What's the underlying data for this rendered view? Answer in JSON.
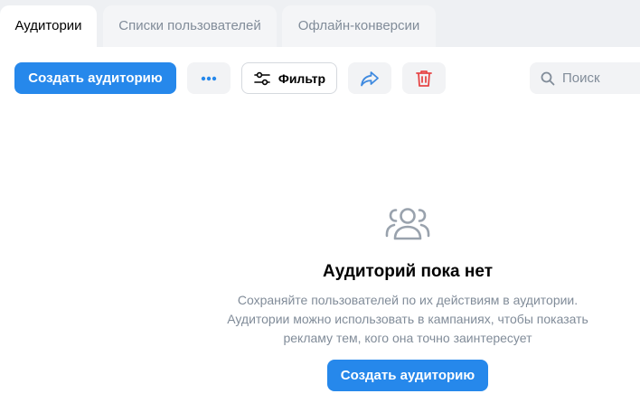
{
  "tabs": [
    {
      "label": "Аудитории",
      "active": true
    },
    {
      "label": "Списки пользователей",
      "active": false
    },
    {
      "label": "Офлайн-конверсии",
      "active": false
    }
  ],
  "toolbar": {
    "create_label": "Создать аудиторию",
    "more_icon": "more-horizontal-icon",
    "filter_label": "Фильтр",
    "filter_icon": "sliders-icon",
    "share_icon": "share-arrow-icon",
    "delete_icon": "trash-icon"
  },
  "search": {
    "placeholder": "Поиск",
    "value": ""
  },
  "empty_state": {
    "icon": "users-outline-icon",
    "title": "Аудиторий пока нет",
    "description_lines": [
      "Сохраняйте пользователей по их действиям в аудитории.",
      "Аудитории можно использовать в кампаниях, чтобы показать",
      "рекламу тем, кого она точно заинтересует"
    ],
    "button_label": "Создать аудиторию"
  },
  "colors": {
    "accent": "#2688eb",
    "muted_text": "#818c99",
    "tab_bar_bg": "#eef0f3",
    "secondary_bg": "#f2f3f5",
    "delete_icon": "#e64646",
    "share_icon": "#3f8ae0",
    "empty_icon": "#99a2ad"
  }
}
